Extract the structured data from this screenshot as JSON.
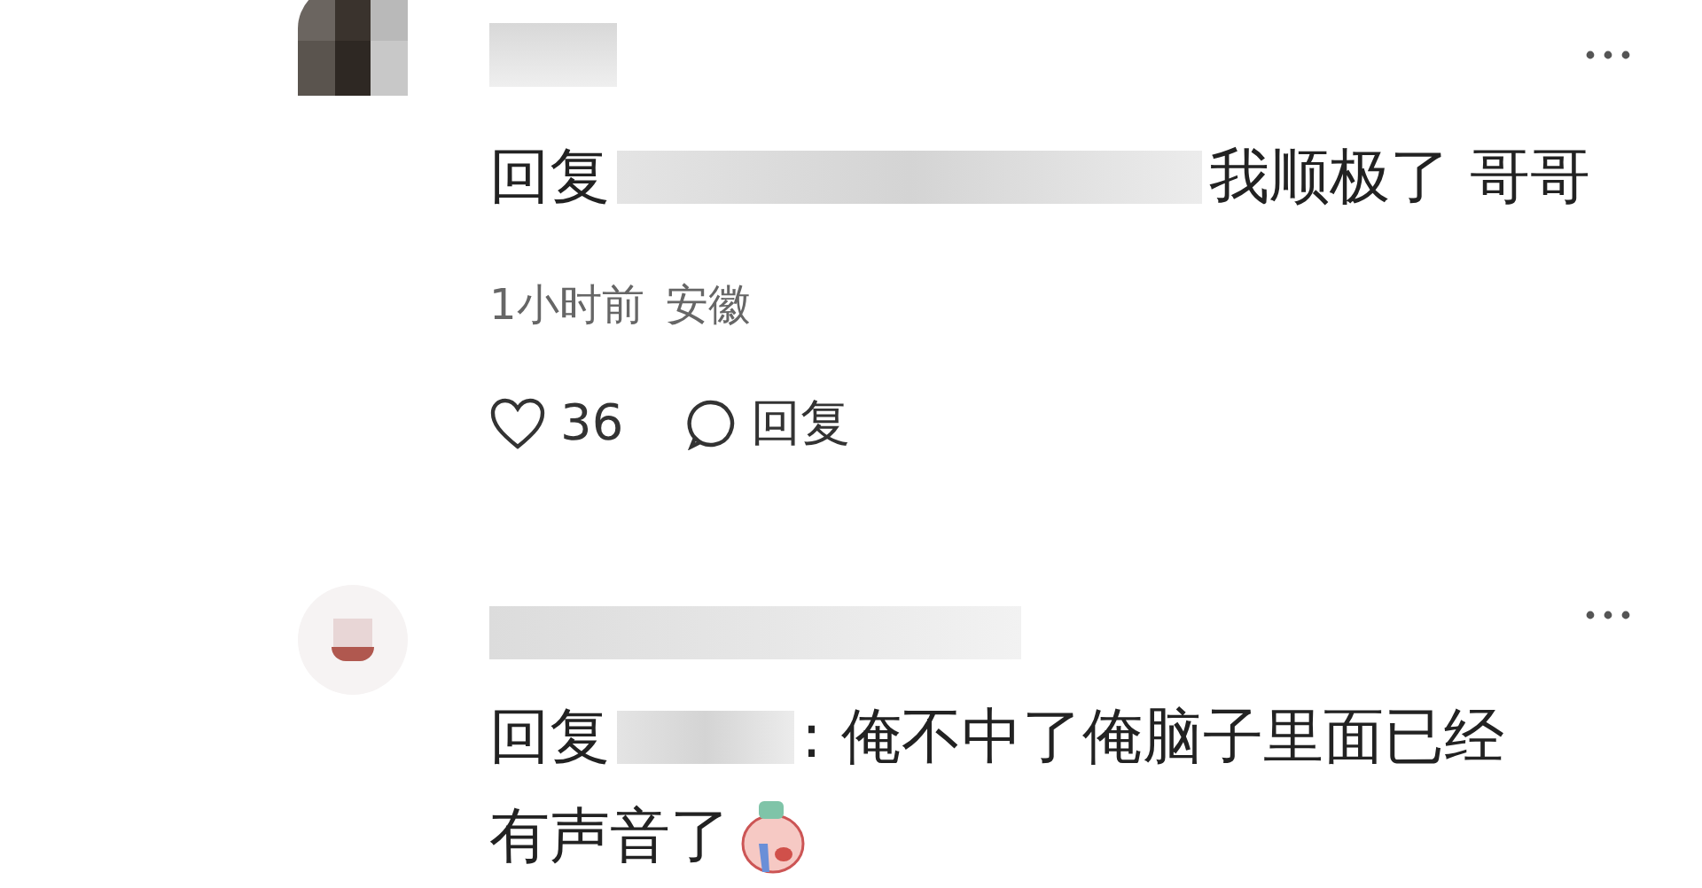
{
  "comments": [
    {
      "kind": "square",
      "reply_label": "回复",
      "lines": [
        "我顺极了 哥哥"
      ],
      "time": "1小时前",
      "location": "安徽",
      "likes": "36",
      "reply_button": "回复",
      "emoji": false
    },
    {
      "kind": "round",
      "reply_label": "回复",
      "lines": [
        ": 俺不中了俺脑子里面已经",
        "有声音了"
      ],
      "emoji": true
    }
  ]
}
